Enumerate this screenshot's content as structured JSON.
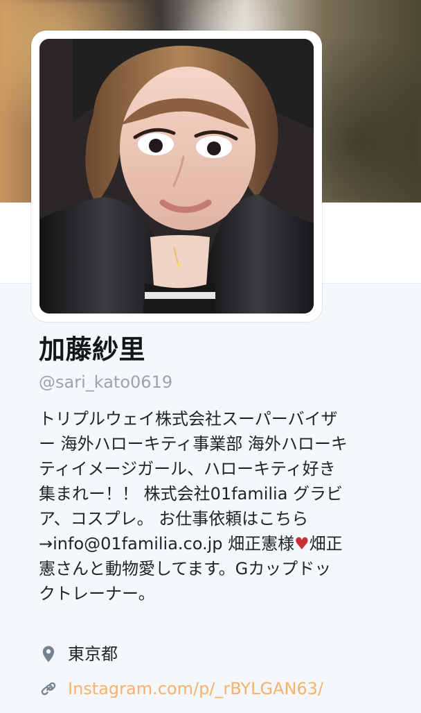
{
  "profile": {
    "name": "加藤紗里",
    "handle": "@sari_kato0619",
    "bio_lines": [
      "トリプルウェイ株式会社スーパーバイザ",
      "ー 海外ハローキティ事業部 海外ハローキ",
      "ティイメージガール、ハローキティ好き",
      "集まれー！！ 株式会社01familia グラビ",
      "ア、コスプレ。 お仕事依頼はこちら",
      "→info@01familia.co.jp 畑正憲様",
      "憲さんと動物愛してます。Gカップドッ",
      "クトレーナー。"
    ],
    "bio_line_6_suffix": "畑正",
    "location": "東京都",
    "website": "Instagram.com/p/_rBYLGAN63/"
  },
  "icons": {
    "heart": "heart-icon",
    "location": "location-pin-icon",
    "link": "link-icon"
  },
  "colors": {
    "name": "#14171a",
    "handle": "#9aa4ae",
    "body_text": "#1f2329",
    "link": "#f6b26b",
    "heart": "#c72f39",
    "background": "#f4f7fb"
  }
}
